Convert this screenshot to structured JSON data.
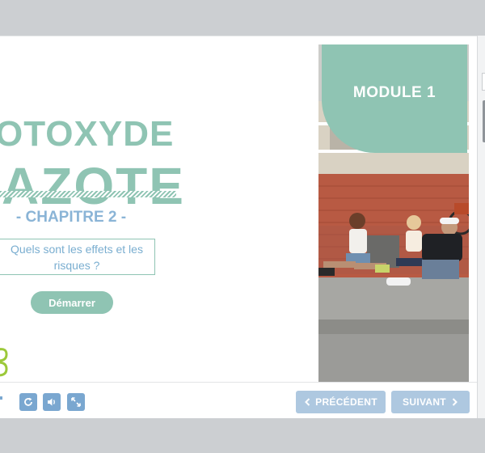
{
  "slide": {
    "title_line1": "OTOXYDE",
    "title_line2": "AZOTE",
    "chapter": "- CHAPITRE 2 -",
    "question": "Quels sont les effets et les risques ?",
    "start_label": "Démarrer",
    "module_label": "MODULE 1"
  },
  "controls": {
    "icons": [
      "reload-icon",
      "volume-icon",
      "fullscreen-icon"
    ],
    "prev_label": "PRÉCÉDENT",
    "next_label": "SUIVANT"
  },
  "colors": {
    "accent_green": "#8fc4b3",
    "accent_blue": "#8ab4d6",
    "button_blue": "#aec8e0"
  }
}
